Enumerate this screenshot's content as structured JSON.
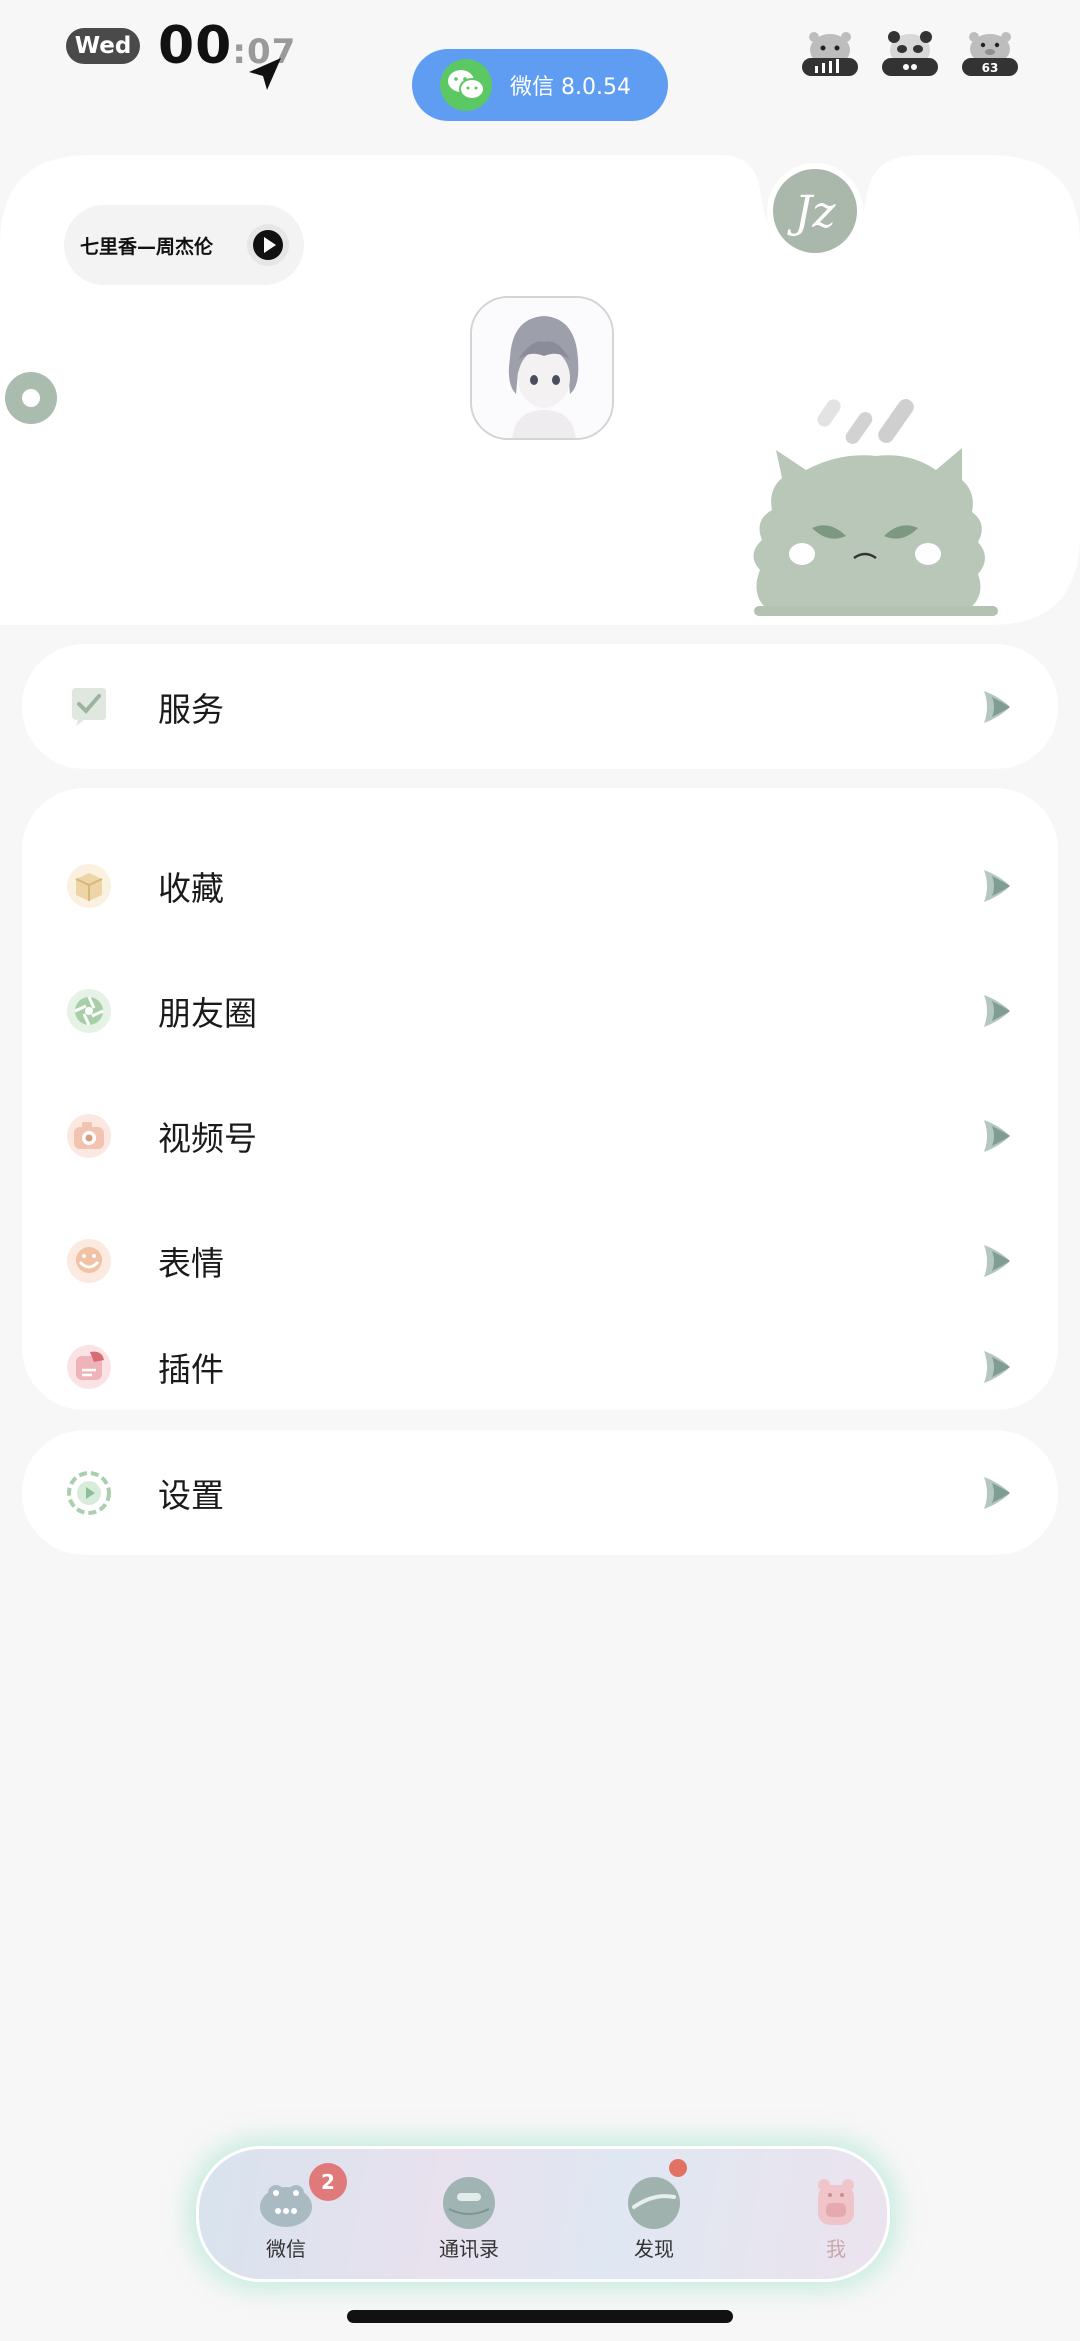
{
  "status": {
    "day": "Wed",
    "hour": "00",
    "minute_sep": ":07",
    "battery": "63"
  },
  "notification": {
    "app_label": "微信 8.0.54"
  },
  "profile": {
    "music_title": "七里香—周杰伦",
    "badge_text": "Jz"
  },
  "menu": {
    "services": "服务",
    "favorites": "收藏",
    "moments": "朋友圈",
    "channels": "视频号",
    "stickers": "表情",
    "plugins": "插件",
    "settings": "设置"
  },
  "tabbar": {
    "tabs": [
      {
        "label": "微信",
        "badge": "2"
      },
      {
        "label": "通讯录"
      },
      {
        "label": "发现"
      },
      {
        "label": "我"
      }
    ]
  },
  "colors": {
    "accent_blue": "#5f9df2",
    "wechat_green": "#5bc863",
    "icon_sage": "#a8bcae",
    "badge_red": "#e0797a"
  }
}
